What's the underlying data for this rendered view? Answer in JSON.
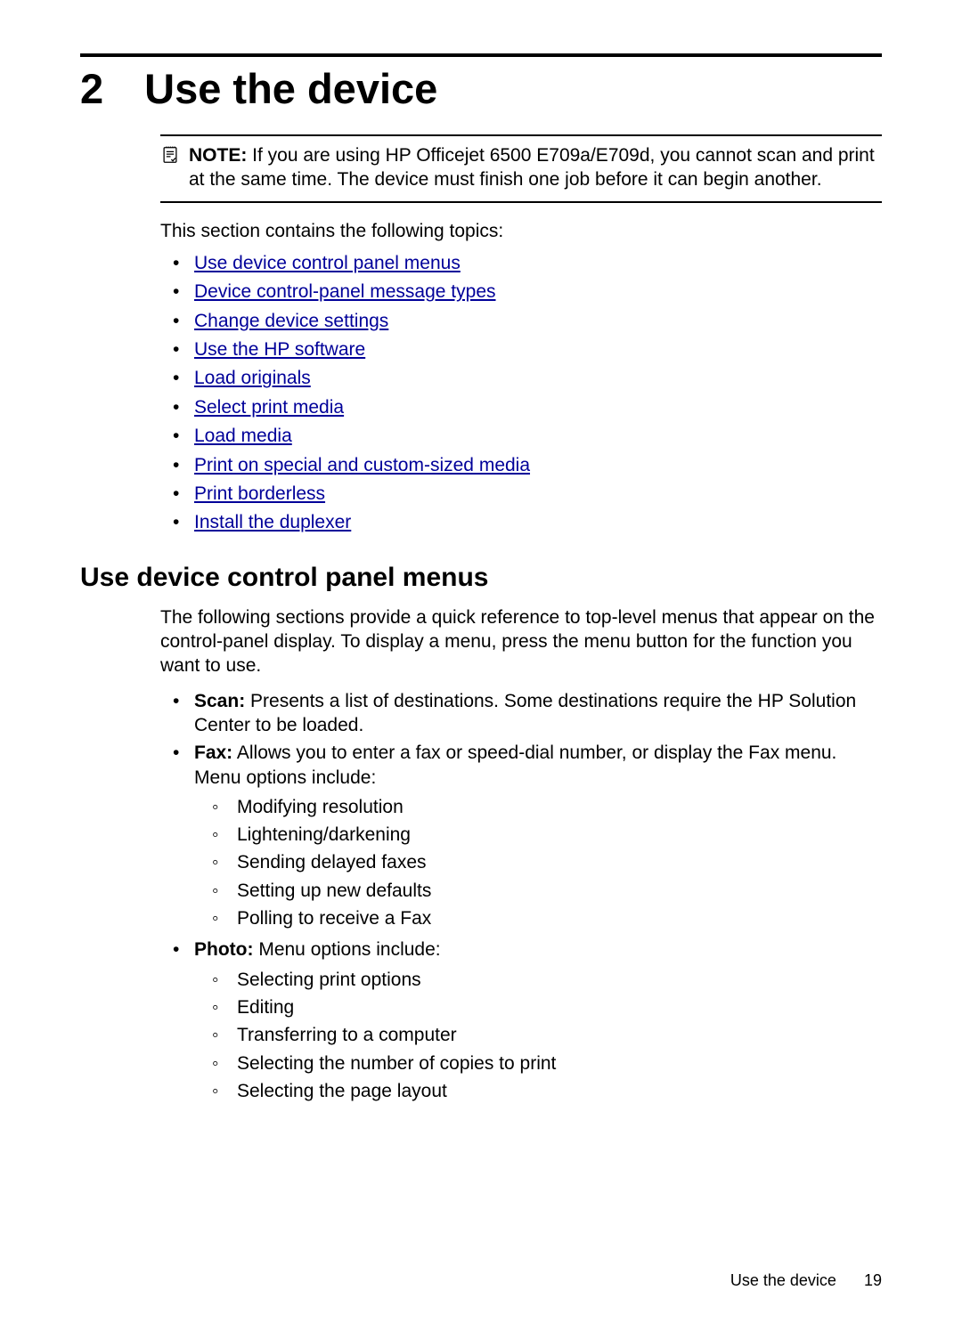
{
  "chapter": {
    "number": "2",
    "title": "Use the device"
  },
  "note": {
    "label": "NOTE:",
    "text": "If you are using HP Officejet 6500 E709a/E709d, you cannot scan and print at the same time. The device must finish one job before it can begin another."
  },
  "intro": "This section contains the following topics:",
  "toc_links": [
    "Use device control panel menus",
    "Device control-panel message types",
    "Change device settings",
    "Use the HP software",
    "Load originals",
    "Select print media",
    "Load media",
    "Print on special and custom-sized media",
    "Print borderless",
    "Install the duplexer"
  ],
  "section": {
    "title": "Use device control panel menus",
    "para": "The following sections provide a quick reference to top-level menus that appear on the control-panel display. To display a menu, press the menu button for the function you want to use.",
    "items": [
      {
        "lead": "Scan:",
        "text": "Presents a list of destinations. Some destinations require the HP Solution Center to be loaded.",
        "sub": []
      },
      {
        "lead": "Fax:",
        "text": "Allows you to enter a fax or speed-dial number, or display the Fax menu. Menu options include:",
        "sub": [
          "Modifying resolution",
          "Lightening/darkening",
          "Sending delayed faxes",
          "Setting up new defaults",
          "Polling to receive a Fax"
        ]
      },
      {
        "lead": "Photo:",
        "text": "Menu options include:",
        "sub": [
          "Selecting print options",
          "Editing",
          "Transferring to a computer",
          "Selecting the number of copies to print",
          "Selecting the page layout"
        ]
      }
    ]
  },
  "footer": {
    "title": "Use the device",
    "page": "19"
  }
}
